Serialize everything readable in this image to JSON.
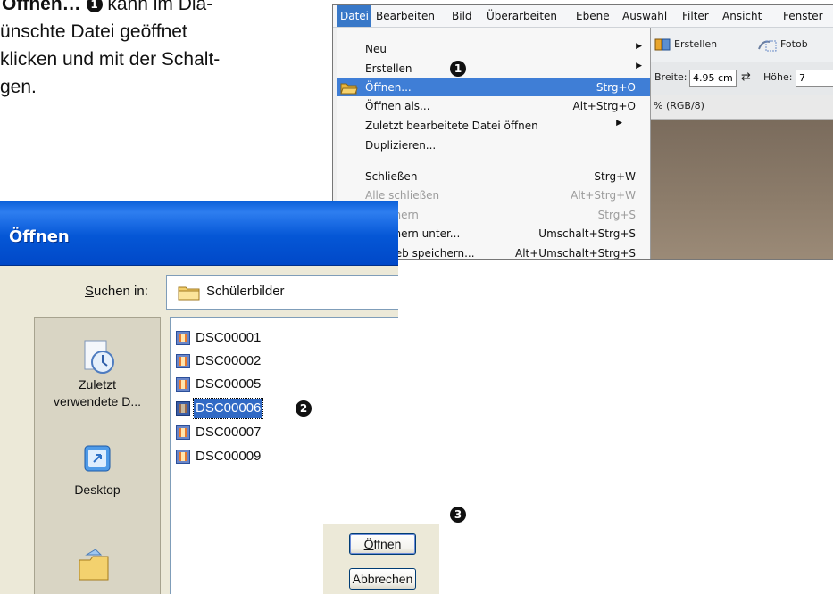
{
  "doc_text": {
    "line1_a": "Öffnen…",
    "line1_num": "1",
    "line1_b": " kann im Dia-",
    "line2": "ünschte Datei geöffnet",
    "line3": "klicken und mit der Schalt-",
    "line4": "gen."
  },
  "pse": {
    "menubar": [
      "Datei",
      "Bearbeiten",
      "Bild",
      "Überarbeiten",
      "Ebene",
      "Auswahl",
      "Filter",
      "Ansicht",
      "Fenster"
    ],
    "toolbar": {
      "create": "Erstellen",
      "photobook": "Fotob"
    },
    "options": {
      "width_label": "Breite:",
      "width_value": "4.95 cm",
      "height_label": "Höhe:",
      "height_value": "7"
    },
    "doc_tab": "% (RGB/8)",
    "menu": [
      {
        "label": "Neu",
        "shortcut": "",
        "submenu": true
      },
      {
        "label": "Erstellen",
        "shortcut": "",
        "submenu": true,
        "marker": "1"
      },
      {
        "label": "Öffnen...",
        "shortcut": "Strg+O",
        "highlight": true
      },
      {
        "label": "Öffnen als...",
        "shortcut": "Alt+Strg+O"
      },
      {
        "label": "Zuletzt bearbeitete Datei öffnen",
        "shortcut": "",
        "submenu": true
      },
      {
        "label": "Duplizieren...",
        "shortcut": ""
      },
      {
        "label": "Schließen",
        "shortcut": "Strg+W"
      },
      {
        "label": "Alle schließen",
        "shortcut": "Alt+Strg+W",
        "disabled": true
      },
      {
        "label": "Speichern",
        "shortcut": "Strg+S",
        "disabled": true
      },
      {
        "label": "Speichern unter...",
        "shortcut": "Umschalt+Strg+S"
      },
      {
        "label": "Für Web speichern...",
        "shortcut": "Alt+Umschalt+Strg+S"
      }
    ]
  },
  "dialog": {
    "title": "Öffnen",
    "lookin_label_u": "S",
    "lookin_label_rest": "uchen in:",
    "lookin_value": "Schülerbilder",
    "places": [
      {
        "line1": "Zuletzt",
        "line2": "verwendete D..."
      },
      {
        "line1": "Desktop",
        "line2": ""
      }
    ],
    "files": [
      "DSC00001",
      "DSC00002",
      "DSC00005",
      "DSC00006",
      "DSC00007",
      "DSC00009"
    ],
    "selected_index": 3,
    "marker2": "2",
    "marker3": "3",
    "btn_open_u": "Ö",
    "btn_open_rest": "ffnen",
    "btn_cancel": "Abbrechen"
  }
}
